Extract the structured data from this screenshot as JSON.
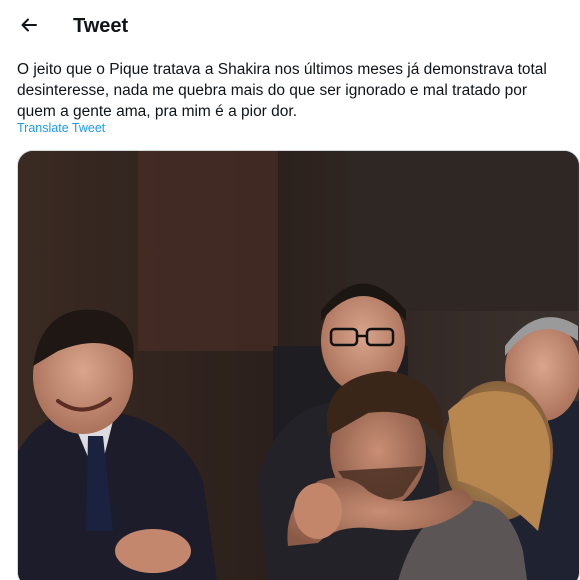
{
  "header": {
    "title": "Tweet",
    "back_icon": "arrow-left-icon"
  },
  "tweet": {
    "text": "O jeito que o Pique tratava a Shakira nos últimos meses já demonstrava total desinteresse, nada me quebra mais do que ser ignorado e mal tratado por quem a gente ama, pra mim é a pior dor.",
    "translate_label": "Translate Tweet",
    "accent_color": "#1d9bf0"
  },
  "media": {
    "type": "photo"
  }
}
